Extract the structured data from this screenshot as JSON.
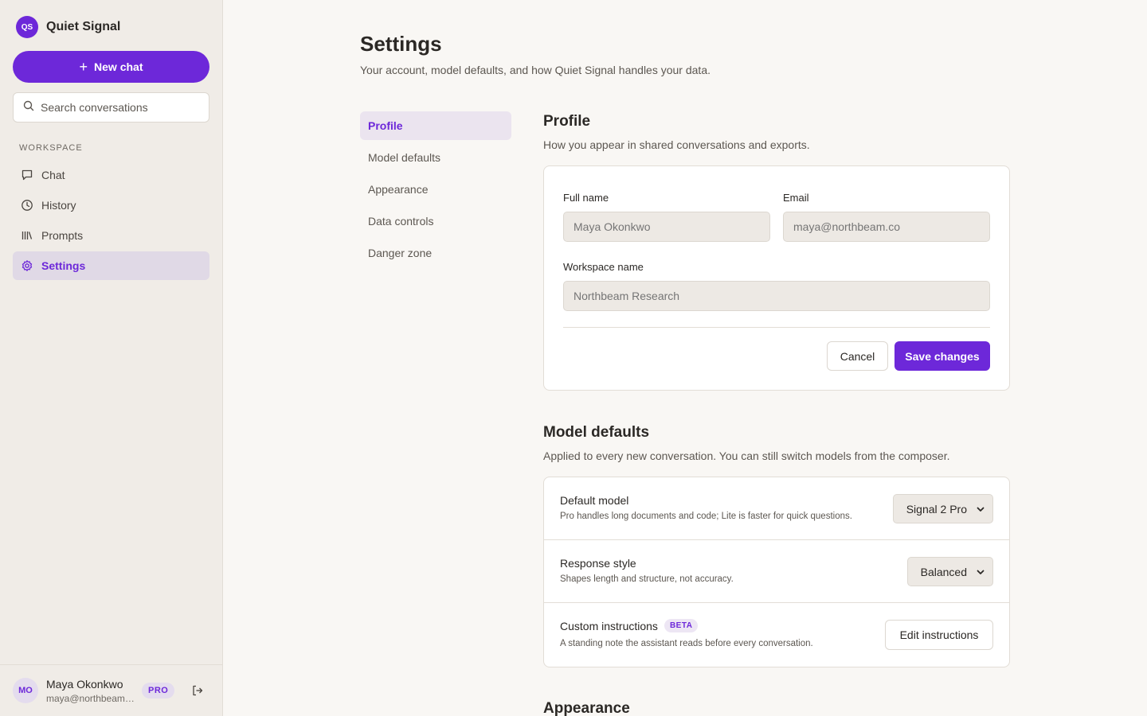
{
  "brand": {
    "logo": "QS",
    "name": "Quiet Signal"
  },
  "sidebar": {
    "new_chat_label": "New chat",
    "search_placeholder": "Search conversations",
    "section_label": "WORKSPACE",
    "items": [
      {
        "label": "Chat",
        "icon": "chat-icon"
      },
      {
        "label": "History",
        "icon": "clock-icon"
      },
      {
        "label": "Prompts",
        "icon": "library-icon"
      },
      {
        "label": "Settings",
        "icon": "gear-icon"
      }
    ],
    "active_index": 3
  },
  "user": {
    "initials": "MO",
    "name": "Maya Okonkwo",
    "email": "maya@northbeam....",
    "badge": "PRO"
  },
  "header": {
    "title": "Settings",
    "subtitle": "Your account, model defaults, and how Quiet Signal handles your data."
  },
  "settings_nav": {
    "items": [
      "Profile",
      "Model defaults",
      "Appearance",
      "Data controls",
      "Danger zone"
    ],
    "active_index": 0
  },
  "profile": {
    "title": "Profile",
    "description": "How you appear in shared conversations and exports.",
    "full_name_label": "Full name",
    "full_name_placeholder": "Maya Okonkwo",
    "email_label": "Email",
    "email_placeholder": "maya@northbeam.co",
    "workspace_label": "Workspace name",
    "workspace_placeholder": "Northbeam Research",
    "cancel_label": "Cancel",
    "save_label": "Save changes"
  },
  "model_defaults": {
    "title": "Model defaults",
    "description": "Applied to every new conversation. You can still switch models from the composer.",
    "default_model": {
      "title": "Default model",
      "desc": "Pro handles long documents and code; Lite is faster for quick questions.",
      "value": "Signal 2 Pro"
    },
    "response_style": {
      "title": "Response style",
      "desc": "Shapes length and structure, not accuracy.",
      "value": "Balanced"
    },
    "custom_instructions": {
      "title": "Custom instructions",
      "badge": "BETA",
      "desc": "A standing note the assistant reads before every conversation.",
      "button": "Edit instructions"
    }
  },
  "appearance": {
    "title": "Appearance"
  },
  "colors": {
    "accent": "#6d28d9",
    "sidebar_bg": "#f0ece7",
    "page_bg": "#f9f7f4"
  }
}
